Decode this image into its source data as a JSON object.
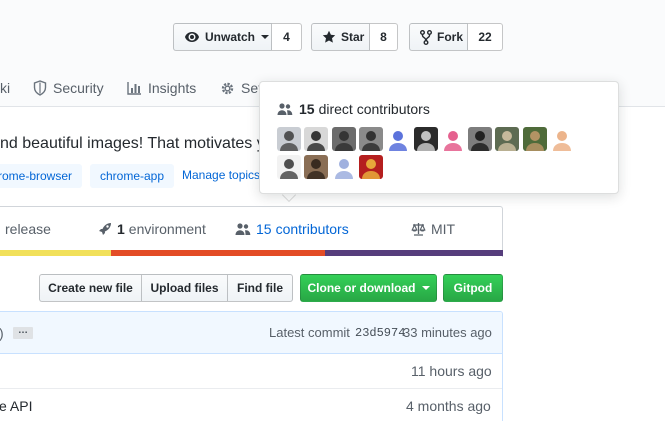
{
  "repo_actions": {
    "watch": {
      "label": "Unwatch",
      "count": "4",
      "icon": "eye-icon"
    },
    "star": {
      "label": "Star",
      "count": "8",
      "icon": "star-icon"
    },
    "fork": {
      "label": "Fork",
      "count": "22",
      "icon": "repo-forked-icon"
    }
  },
  "tabs": [
    {
      "label": "ki"
    },
    {
      "label": "Security",
      "icon": "shield-icon"
    },
    {
      "label": "Insights",
      "icon": "graph-icon"
    },
    {
      "label": "Set",
      "icon": "gear-icon"
    }
  ],
  "description": "nd beautiful images! That motivates y",
  "topics": [
    "rome-browser",
    "chrome-app"
  ],
  "manage_topics": "Manage topics",
  "summary": {
    "release": {
      "label": "release"
    },
    "environment": {
      "count": "1",
      "label": "environment"
    },
    "contributors": {
      "count": "15",
      "label": "contributors"
    },
    "license": {
      "label": "MIT"
    }
  },
  "language_bar": [
    {
      "color": "#f1e05a",
      "share": 0.235
    },
    {
      "color": "#e34c26",
      "share": 0.418
    },
    {
      "color": "#563d7c",
      "share": 0.347
    }
  ],
  "file_buttons": {
    "create": "Create new file",
    "upload": "Upload files",
    "find": "Find file",
    "clone": "Clone or download",
    "gitpod": "Gitpod"
  },
  "commit_tease": {
    "fragment": ")",
    "ellipsis": "…",
    "prefix": "Latest commit",
    "sha": "23d5974",
    "age": "33 minutes ago"
  },
  "files": [
    {
      "name": "",
      "age": "11 hours ago"
    },
    {
      "name": "e API",
      "age": "4 months ago"
    }
  ],
  "popover": {
    "count": "15",
    "label": "direct contributors",
    "avatars": [
      {
        "name": "contributor-avatar-1",
        "bg": "#c9cdd3",
        "fg": "#3b3b3b"
      },
      {
        "name": "contributor-avatar-2",
        "bg": "#d8d8d8",
        "fg": "#1a1a1a"
      },
      {
        "name": "contributor-avatar-3",
        "bg": "#6b6b6b",
        "fg": "#2a2a2a"
      },
      {
        "name": "contributor-avatar-4",
        "bg": "#8a8a8a",
        "fg": "#222"
      },
      {
        "name": "contributor-avatar-5",
        "bg": "#ffffff",
        "fg": "#3f5ad6"
      },
      {
        "name": "contributor-avatar-6",
        "bg": "#2b2b2b",
        "fg": "#ddd"
      },
      {
        "name": "contributor-avatar-7",
        "bg": "#ffffff",
        "fg": "#e0457b"
      },
      {
        "name": "contributor-avatar-8",
        "bg": "#7d7d7d",
        "fg": "#111"
      },
      {
        "name": "contributor-avatar-9",
        "bg": "#5d6b52",
        "fg": "#d8c7a8"
      },
      {
        "name": "contributor-avatar-10",
        "bg": "#4f6b3a",
        "fg": "#c49a6c"
      },
      {
        "name": "contributor-avatar-11",
        "bg": "#ffffff",
        "fg": "#e9a777"
      },
      {
        "name": "contributor-avatar-12",
        "bg": "#f2f2f2",
        "fg": "#333"
      },
      {
        "name": "contributor-avatar-13",
        "bg": "#8a6e55",
        "fg": "#2a2018"
      },
      {
        "name": "contributor-avatar-14",
        "bg": "#ffffff",
        "fg": "#8fa3d9"
      },
      {
        "name": "contributor-avatar-15",
        "bg": "#b51f1f",
        "fg": "#f0c040"
      }
    ]
  }
}
